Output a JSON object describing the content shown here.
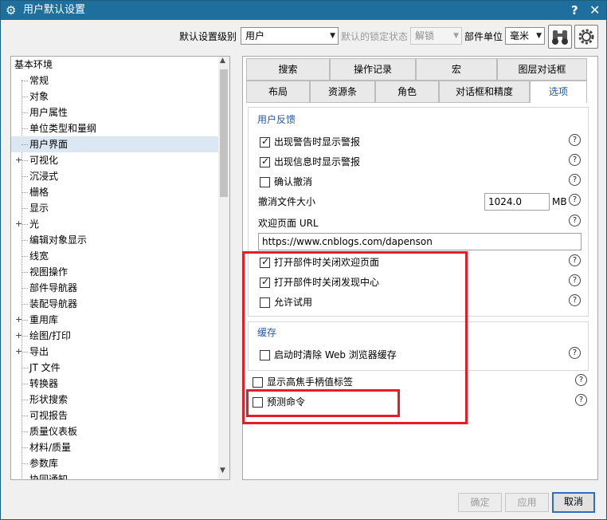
{
  "window": {
    "title": "用户默认设置",
    "help": "?",
    "close": "✕"
  },
  "toolbar": {
    "level_label": "默认设置级别",
    "level_value": "用户",
    "lock_label": "默认的锁定状态",
    "lock_value": "解锁",
    "unit_label": "部件单位",
    "unit_value": "毫米"
  },
  "tree": {
    "root": "基本环境",
    "items": [
      {
        "label": "常规",
        "expandable": false
      },
      {
        "label": "对象",
        "expandable": false
      },
      {
        "label": "用户属性",
        "expandable": false
      },
      {
        "label": "单位类型和量纲",
        "expandable": false
      },
      {
        "label": "用户界面",
        "expandable": false,
        "selected": true
      },
      {
        "label": "可视化",
        "expandable": true
      },
      {
        "label": "沉浸式",
        "expandable": false
      },
      {
        "label": "栅格",
        "expandable": false
      },
      {
        "label": "显示",
        "expandable": false
      },
      {
        "label": "光",
        "expandable": true
      },
      {
        "label": "编辑对象显示",
        "expandable": false
      },
      {
        "label": "线宽",
        "expandable": false
      },
      {
        "label": "视图操作",
        "expandable": false
      },
      {
        "label": "部件导航器",
        "expandable": false
      },
      {
        "label": "装配导航器",
        "expandable": false
      },
      {
        "label": "重用库",
        "expandable": true
      },
      {
        "label": "绘图/打印",
        "expandable": true
      },
      {
        "label": "导出",
        "expandable": true
      },
      {
        "label": "JT 文件",
        "expandable": false
      },
      {
        "label": "转换器",
        "expandable": false
      },
      {
        "label": "形状搜索",
        "expandable": false
      },
      {
        "label": "可视报告",
        "expandable": false
      },
      {
        "label": "质量仪表板",
        "expandable": false
      },
      {
        "label": "材料/质量",
        "expandable": false
      },
      {
        "label": "参数库",
        "expandable": false
      },
      {
        "label": "协同通知",
        "expandable": false
      }
    ]
  },
  "tabs": {
    "row1": [
      "搜索",
      "操作记录",
      "宏",
      "图层对话框"
    ],
    "row2": [
      "布局",
      "资源条",
      "角色",
      "对话框和精度",
      "选项"
    ],
    "active": "选项"
  },
  "feedback": {
    "title": "用户反馈",
    "show_warning": {
      "label": "出现警告时显示警报",
      "checked": true
    },
    "show_info": {
      "label": "出现信息时显示警报",
      "checked": true
    },
    "confirm_undo": {
      "label": "确认撤消",
      "checked": false
    },
    "undo_size_label": "撤消文件大小",
    "undo_size_value": "1024.0",
    "undo_size_unit": "MB",
    "welcome_label": "欢迎页面 URL",
    "welcome_url": "https://www.cnblogs.com/dapenson",
    "close_welcome": {
      "label": "打开部件时关闭欢迎页面",
      "checked": true
    },
    "close_discovery": {
      "label": "打开部件时关闭发现中心",
      "checked": true
    },
    "allow_trial": {
      "label": "允许试用",
      "checked": false
    }
  },
  "cache": {
    "title": "缓存",
    "clear_web_cache": {
      "label": "启动时清除 Web 浏览器缓存",
      "checked": false
    }
  },
  "misc": {
    "show_focus_handle": {
      "label": "显示高焦手柄值标签",
      "checked": false
    },
    "predict_command": {
      "label": "预测命令",
      "checked": false
    }
  },
  "help_glyph": "?",
  "buttons": {
    "ok": "确定",
    "apply": "应用",
    "cancel": "取消"
  },
  "colors": {
    "titlebar": "#1f6f9e",
    "accent_text": "#2659a8",
    "highlight_box": "#e41e26",
    "selection": "#dbe7f3"
  }
}
